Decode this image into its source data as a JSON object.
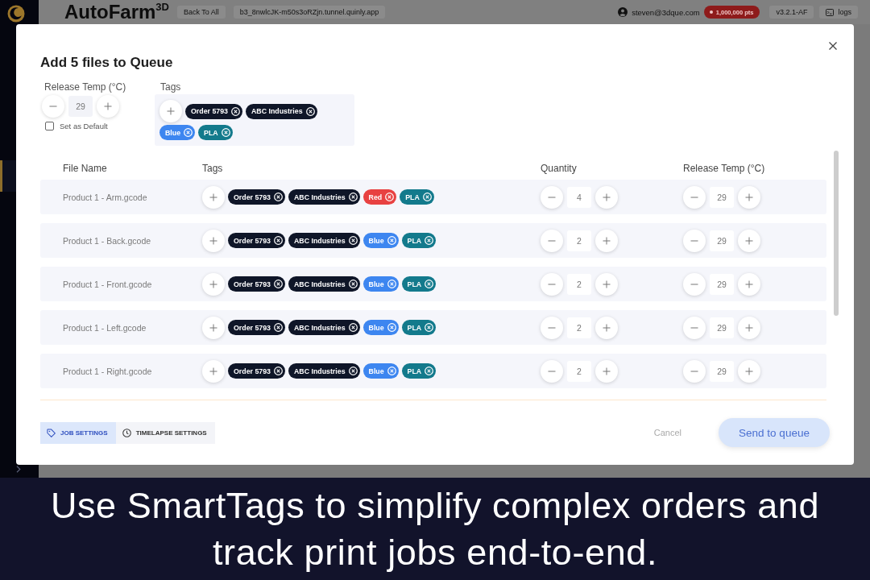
{
  "app_header": {
    "logo": "AutoFarm$^{3D}$",
    "back_button": "Back To All",
    "host": "b3_8nwlcJK-m50s3oRZjn.tunnel.quinly.app",
    "user_email": "steven@3dque.com",
    "points": "1,000,000 pts",
    "version": "v3.2.1-AF",
    "logs_button": "logs"
  },
  "dialog": {
    "title": "Add 5 files to Queue",
    "release_temp": {
      "label": "Release Temp (°C)",
      "value": "29",
      "set_default": {
        "label": "Set as Default",
        "checked": false
      }
    },
    "tags": {
      "label": "Tags",
      "items": [
        {
          "label": "Order 5793",
          "color": "#0f1628"
        },
        {
          "label": "ABC Industries",
          "color": "#0f1628"
        },
        {
          "label": "Blue",
          "color": "#3d86f0"
        },
        {
          "label": "PLA",
          "color": "#137a8c"
        }
      ]
    },
    "table": {
      "columns": [
        "File Name",
        "Tags",
        "Quantity",
        "Release Temp (°C)"
      ],
      "rows": [
        {
          "file": "Product 1 - Arm.gcode",
          "tags": [
            {
              "label": "Order 5793",
              "color": "#0f1628"
            },
            {
              "label": "ABC Industries",
              "color": "#0f1628"
            },
            {
              "label": "Red",
              "color": "#e84141"
            },
            {
              "label": "PLA",
              "color": "#137a8c"
            }
          ],
          "quantity": "4",
          "release_temp": "29"
        },
        {
          "file": "Product 1 - Back.gcode",
          "tags": [
            {
              "label": "Order 5793",
              "color": "#0f1628"
            },
            {
              "label": "ABC Industries",
              "color": "#0f1628"
            },
            {
              "label": "Blue",
              "color": "#3d86f0"
            },
            {
              "label": "PLA",
              "color": "#137a8c"
            }
          ],
          "quantity": "2",
          "release_temp": "29"
        },
        {
          "file": "Product 1 - Front.gcode",
          "tags": [
            {
              "label": "Order 5793",
              "color": "#0f1628"
            },
            {
              "label": "ABC Industries",
              "color": "#0f1628"
            },
            {
              "label": "Blue",
              "color": "#3d86f0"
            },
            {
              "label": "PLA",
              "color": "#137a8c"
            }
          ],
          "quantity": "2",
          "release_temp": "29"
        },
        {
          "file": "Product 1 - Left.gcode",
          "tags": [
            {
              "label": "Order 5793",
              "color": "#0f1628"
            },
            {
              "label": "ABC Industries",
              "color": "#0f1628"
            },
            {
              "label": "Blue",
              "color": "#3d86f0"
            },
            {
              "label": "PLA",
              "color": "#137a8c"
            }
          ],
          "quantity": "2",
          "release_temp": "29"
        },
        {
          "file": "Product 1 - Right.gcode",
          "tags": [
            {
              "label": "Order 5793",
              "color": "#0f1628"
            },
            {
              "label": "ABC Industries",
              "color": "#0f1628"
            },
            {
              "label": "Blue",
              "color": "#3d86f0"
            },
            {
              "label": "PLA",
              "color": "#137a8c"
            }
          ],
          "quantity": "2",
          "release_temp": "29"
        }
      ]
    },
    "tabs": [
      {
        "label": "JOB SETTINGS",
        "kind": "tag",
        "selected": true
      },
      {
        "label": "TIMELAPSE SETTINGS",
        "kind": "clock",
        "selected": false
      }
    ],
    "cancel_button": "Cancel",
    "submit_button": "Send to queue"
  },
  "caption": "Use SmartTags to simplify complex orders and track print jobs end-to-end."
}
